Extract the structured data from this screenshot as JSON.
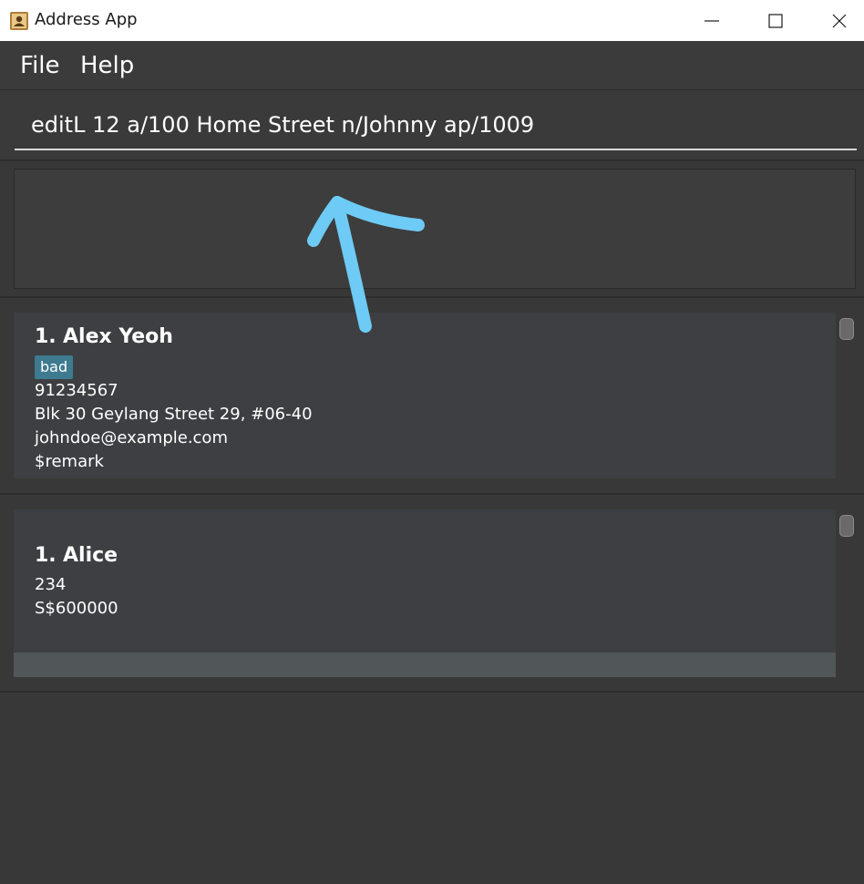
{
  "window": {
    "title": "Address App",
    "controls": [
      "minimize",
      "maximize",
      "close"
    ]
  },
  "menu": {
    "items": [
      {
        "label": "File"
      },
      {
        "label": "Help"
      }
    ]
  },
  "command_box": {
    "value": "editL 12 a/100 Home Street n/Johnny ap/1009"
  },
  "result_display": {
    "text": ""
  },
  "person_list": {
    "cards": [
      {
        "index": "1.",
        "name": "Alex Yeoh",
        "tags": [
          "bad"
        ],
        "phone": "91234567",
        "address": "Blk 30 Geylang Street 29, #06-40",
        "email": "johndoe@example.com",
        "remark": "$remark"
      }
    ]
  },
  "second_list": {
    "cards": [
      {
        "index": "1.",
        "name": "Alice",
        "line1": "234",
        "line2": "S$600000"
      }
    ]
  },
  "colors": {
    "background": "#383838",
    "card": "#3e3f42",
    "tag": "#3e7b91",
    "annotation_arrow": "#6ecbf5"
  },
  "icons": {
    "app": "address-book-icon",
    "annotation": "arrow-up-annotation"
  }
}
